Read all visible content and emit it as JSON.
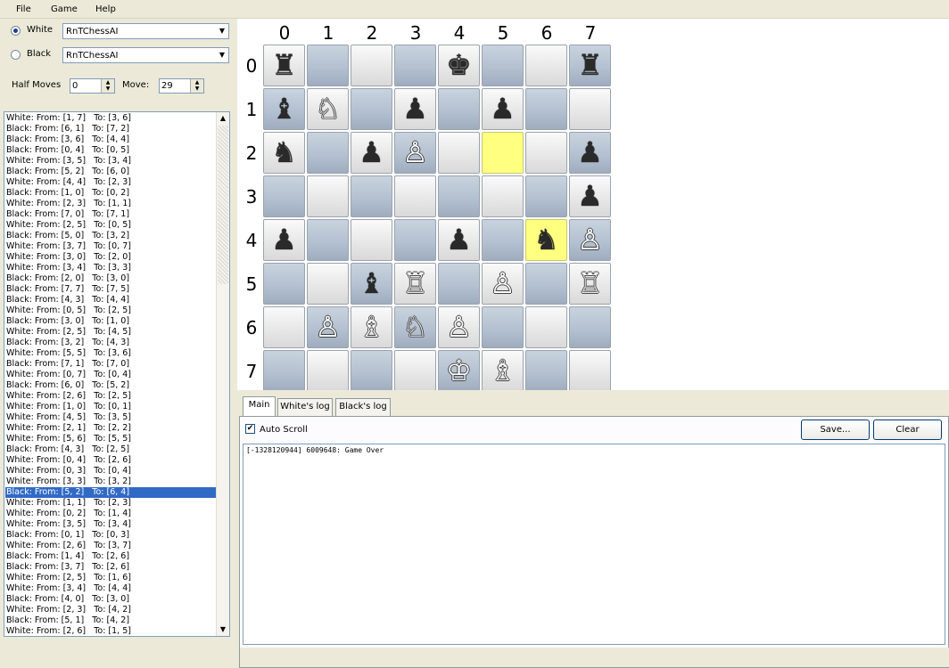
{
  "menu": [
    "File",
    "Game",
    "Help"
  ],
  "white": {
    "label": "White",
    "engine": "RnTChessAI",
    "selected": true
  },
  "black": {
    "label": "Black",
    "engine": "RnTChessAI",
    "selected": false
  },
  "half_moves": {
    "label": "Half Moves",
    "value": "0"
  },
  "move": {
    "label": "Move:",
    "value": "29"
  },
  "moves": [
    "White: From: [1, 7]   To: [3, 6]",
    "Black: From: [6, 1]   To: [7, 2]",
    "Black: From: [3, 6]   To: [4, 4]",
    "Black: From: [0, 4]   To: [0, 5]",
    "White: From: [3, 5]   To: [3, 4]",
    "Black: From: [5, 2]   To: [6, 0]",
    "White: From: [4, 4]   To: [2, 3]",
    "Black: From: [1, 0]   To: [0, 2]",
    "White: From: [2, 3]   To: [1, 1]",
    "Black: From: [7, 0]   To: [7, 1]",
    "White: From: [2, 5]   To: [0, 5]",
    "Black: From: [5, 0]   To: [3, 2]",
    "White: From: [3, 7]   To: [0, 7]",
    "White: From: [3, 0]   To: [2, 0]",
    "White: From: [3, 4]   To: [3, 3]",
    "Black: From: [2, 0]   To: [3, 0]",
    "Black: From: [7, 7]   To: [7, 5]",
    "Black: From: [4, 3]   To: [4, 4]",
    "White: From: [0, 5]   To: [2, 5]",
    "Black: From: [3, 0]   To: [1, 0]",
    "White: From: [2, 5]   To: [4, 5]",
    "Black: From: [3, 2]   To: [4, 3]",
    "White: From: [5, 5]   To: [3, 6]",
    "Black: From: [7, 1]   To: [7, 0]",
    "White: From: [0, 7]   To: [0, 4]",
    "Black: From: [6, 0]   To: [5, 2]",
    "White: From: [2, 6]   To: [2, 5]",
    "White: From: [1, 0]   To: [0, 1]",
    "White: From: [4, 5]   To: [3, 5]",
    "White: From: [2, 1]   To: [2, 2]",
    "White: From: [5, 6]   To: [5, 5]",
    "Black: From: [4, 3]   To: [2, 5]",
    "White: From: [0, 4]   To: [2, 6]",
    "White: From: [0, 3]   To: [0, 4]",
    "White: From: [3, 3]   To: [3, 2]",
    "Black: From: [5, 2]   To: [6, 4]",
    "White: From: [1, 1]   To: [2, 3]",
    "White: From: [0, 2]   To: [1, 4]",
    "White: From: [3, 5]   To: [3, 4]",
    "Black: From: [0, 1]   To: [0, 3]",
    "White: From: [2, 6]   To: [3, 7]",
    "Black: From: [1, 4]   To: [2, 6]",
    "Black: From: [3, 7]   To: [2, 6]",
    "White: From: [2, 5]   To: [1, 6]",
    "White: From: [3, 4]   To: [4, 4]",
    "Black: From: [4, 0]   To: [3, 0]",
    "White: From: [2, 3]   To: [4, 2]",
    "Black: From: [5, 1]   To: [4, 2]",
    "White: From: [2, 6]   To: [1, 5]"
  ],
  "selected_move_index": 35,
  "board": {
    "col_labels": [
      "0",
      "1",
      "2",
      "3",
      "4",
      "5",
      "6",
      "7"
    ],
    "row_labels": [
      "0",
      "1",
      "2",
      "3",
      "4",
      "5",
      "6",
      "7"
    ],
    "pieces": [
      {
        "r": 0,
        "c": 0,
        "glyph": "♜"
      },
      {
        "r": 0,
        "c": 4,
        "glyph": "♚"
      },
      {
        "r": 0,
        "c": 7,
        "glyph": "♜"
      },
      {
        "r": 1,
        "c": 0,
        "glyph": "♝"
      },
      {
        "r": 1,
        "c": 1,
        "glyph": "♘"
      },
      {
        "r": 1,
        "c": 3,
        "glyph": "♟"
      },
      {
        "r": 1,
        "c": 5,
        "glyph": "♟"
      },
      {
        "r": 2,
        "c": 0,
        "glyph": "♞"
      },
      {
        "r": 2,
        "c": 2,
        "glyph": "♟"
      },
      {
        "r": 2,
        "c": 3,
        "glyph": "♙"
      },
      {
        "r": 2,
        "c": 7,
        "glyph": "♟"
      },
      {
        "r": 3,
        "c": 7,
        "glyph": "♟"
      },
      {
        "r": 4,
        "c": 0,
        "glyph": "♟"
      },
      {
        "r": 4,
        "c": 4,
        "glyph": "♟"
      },
      {
        "r": 4,
        "c": 6,
        "glyph": "♞"
      },
      {
        "r": 4,
        "c": 7,
        "glyph": "♙"
      },
      {
        "r": 5,
        "c": 2,
        "glyph": "♝"
      },
      {
        "r": 5,
        "c": 3,
        "glyph": "♖"
      },
      {
        "r": 5,
        "c": 5,
        "glyph": "♙"
      },
      {
        "r": 5,
        "c": 7,
        "glyph": "♖"
      },
      {
        "r": 6,
        "c": 1,
        "glyph": "♙"
      },
      {
        "r": 6,
        "c": 2,
        "glyph": "♗"
      },
      {
        "r": 6,
        "c": 3,
        "glyph": "♘"
      },
      {
        "r": 6,
        "c": 4,
        "glyph": "♙"
      },
      {
        "r": 7,
        "c": 4,
        "glyph": "♔"
      },
      {
        "r": 7,
        "c": 5,
        "glyph": "♗"
      }
    ],
    "highlighted": [
      {
        "r": 2,
        "c": 5
      },
      {
        "r": 4,
        "c": 6
      }
    ]
  },
  "tabs": [
    "Main",
    "White's log",
    "Black's log"
  ],
  "auto_scroll": {
    "label": "Auto Scroll",
    "checked": true
  },
  "save_label": "Save...",
  "clear_label": "Clear",
  "log_text": "[-1328120944] 6009648: Game Over"
}
